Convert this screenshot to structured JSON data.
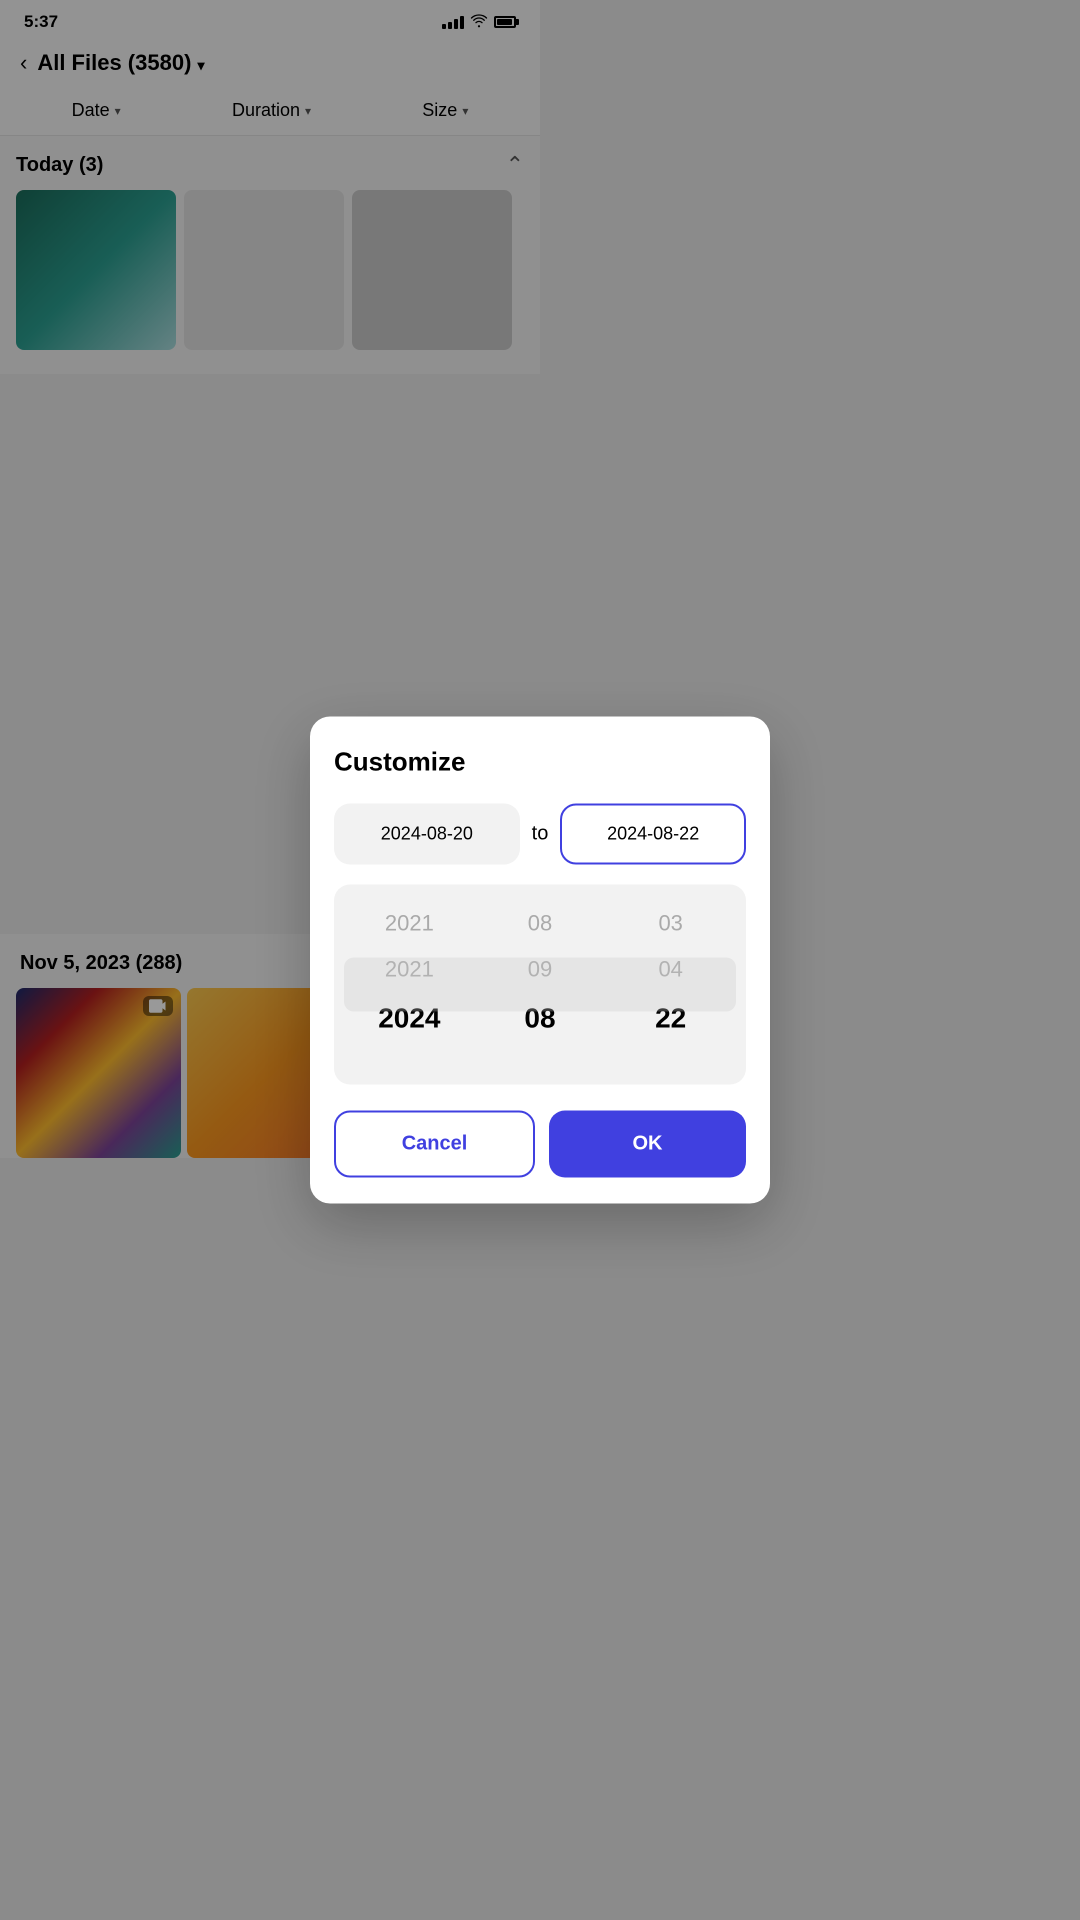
{
  "statusBar": {
    "time": "5:37"
  },
  "header": {
    "back": "‹",
    "title": "All Files (3580)",
    "dropdownArrow": "▾"
  },
  "filterBar": {
    "filters": [
      {
        "label": "Date",
        "id": "date"
      },
      {
        "label": "Duration",
        "id": "duration"
      },
      {
        "label": "Size",
        "id": "size"
      }
    ]
  },
  "sections": {
    "today": "Today (3)",
    "nov": "Nov 5, 2023 (288)"
  },
  "dialog": {
    "title": "Customize",
    "startDate": "2024-08-20",
    "endDate": "2024-08-22",
    "separator": "to",
    "picker": {
      "years": [
        "2021",
        "2021",
        "2024"
      ],
      "months": [
        "08",
        "09",
        "08"
      ],
      "days": [
        "03",
        "04",
        "22"
      ]
    },
    "cancelLabel": "Cancel",
    "okLabel": "OK"
  }
}
